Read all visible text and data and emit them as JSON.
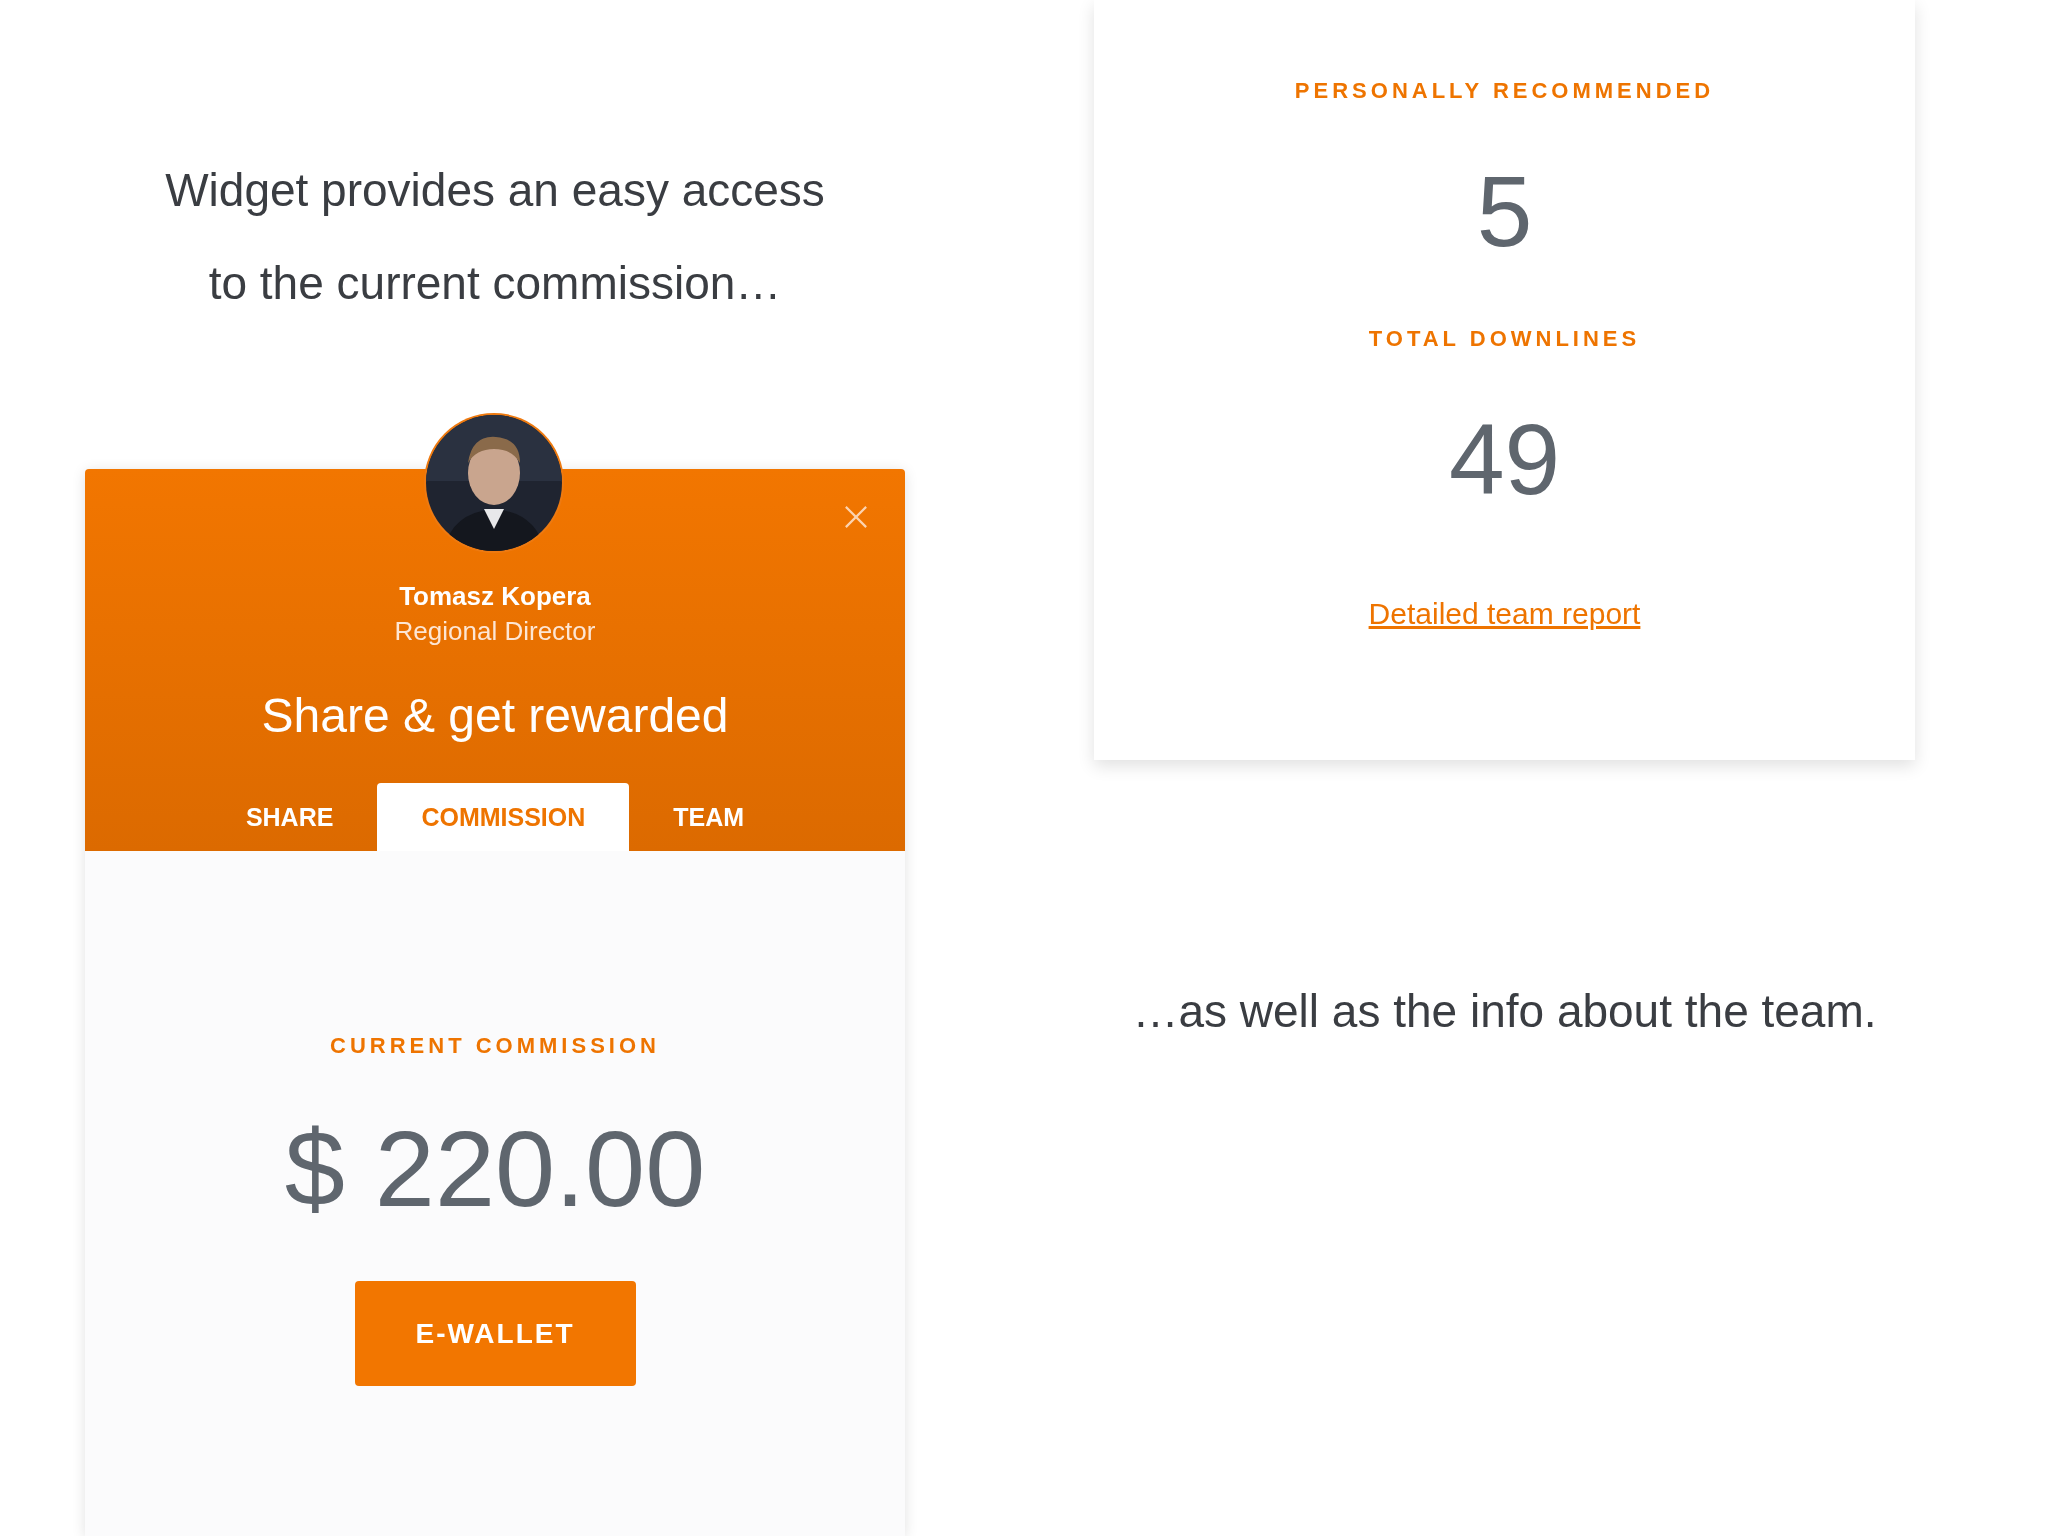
{
  "intro": {
    "lines": [
      "Widget provides an easy access",
      "to the current commission…"
    ]
  },
  "widget": {
    "person": {
      "name": "Tomasz Kopera",
      "role": "Regional Director"
    },
    "headline": "Share & get rewarded",
    "tabs": [
      {
        "label": "SHARE",
        "selected": false
      },
      {
        "label": "COMMISSION",
        "selected": true
      },
      {
        "label": "TEAM",
        "selected": false
      }
    ],
    "commission": {
      "label": "CURRENT COMMISSION",
      "amount": "$ 220.00",
      "button": "E-WALLET"
    }
  },
  "team": {
    "stats": [
      {
        "label": "PERSONALLY RECOMMENDED",
        "value": "5"
      },
      {
        "label": "TOTAL DOWNLINES",
        "value": "49"
      }
    ],
    "link": "Detailed team report"
  },
  "outro": {
    "text": "…as well as the info about the team."
  }
}
